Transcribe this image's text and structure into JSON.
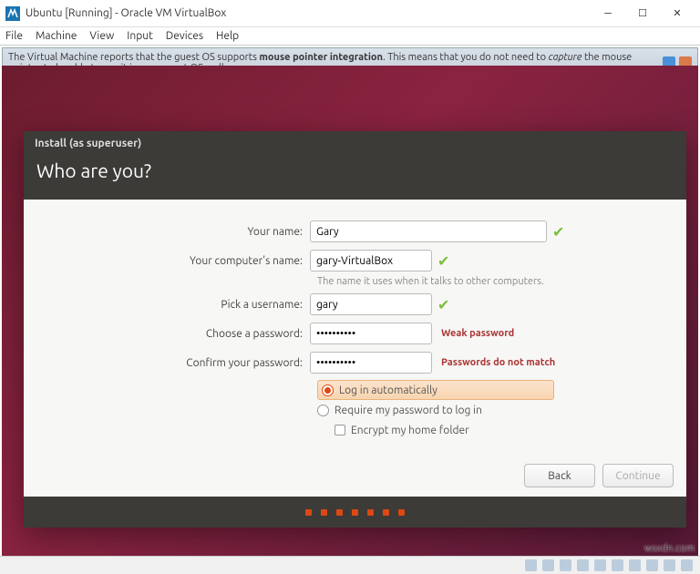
{
  "window": {
    "title": "Ubuntu [Running] - Oracle VM VirtualBox"
  },
  "menu": {
    "file": "File",
    "machine": "Machine",
    "view": "View",
    "input": "Input",
    "devices": "Devices",
    "help": "Help"
  },
  "infobar": {
    "text_a": "The Virtual Machine reports that the guest OS supports ",
    "text_b": "mouse pointer integration",
    "text_c": ". This means that you do not need to ",
    "text_d": "capture",
    "text_e": " the mouse pointer to be able to use it in your guest OS -- all mouse"
  },
  "installer": {
    "title": "Install (as superuser)",
    "heading": "Who are you?",
    "labels": {
      "name": "Your name:",
      "computer": "Your computer's name:",
      "computer_hint": "The name it uses when it talks to other computers.",
      "username": "Pick a username:",
      "password": "Choose a password:",
      "confirm": "Confirm your password:"
    },
    "values": {
      "name": "Gary",
      "computer": "gary-VirtualBox",
      "username": "gary",
      "password": "••••••••••",
      "confirm": "••••••••••"
    },
    "warnings": {
      "weak": "Weak password",
      "mismatch": "Passwords do not match"
    },
    "options": {
      "auto": "Log in automatically",
      "require": "Require my password to log in",
      "encrypt": "Encrypt my home folder"
    },
    "buttons": {
      "back": "Back",
      "continue": "Continue"
    }
  },
  "watermark": "wsxdn.com"
}
